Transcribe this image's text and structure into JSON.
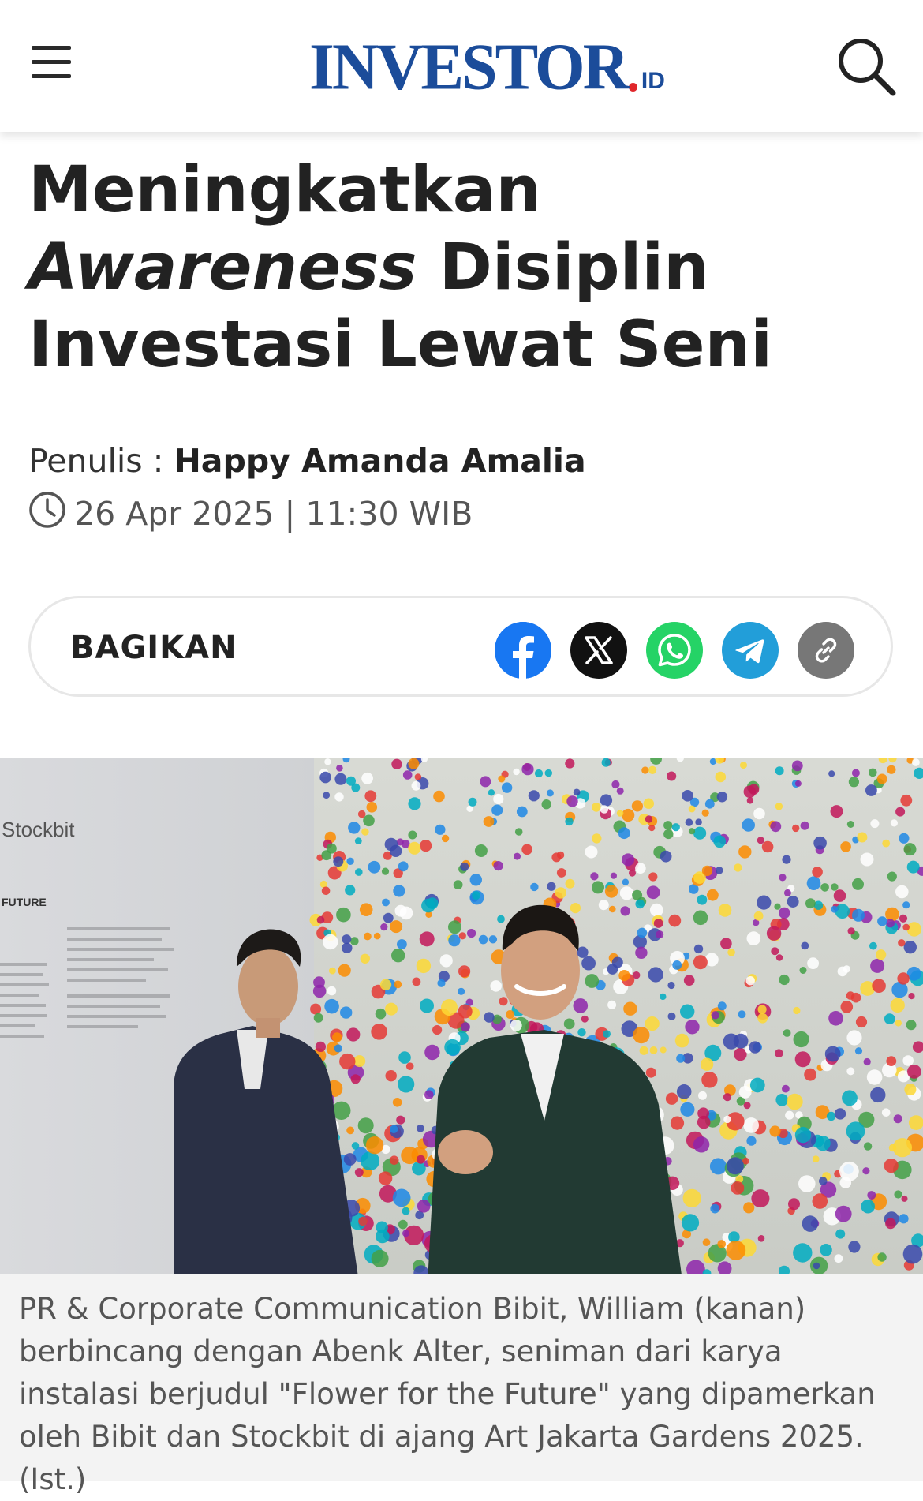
{
  "header": {
    "logo_main": "INVESTOR",
    "logo_suffix": "ID",
    "menu_icon": "hamburger-menu-icon",
    "search_icon": "search-icon"
  },
  "article": {
    "title_part1": "Meningkatkan ",
    "title_italic": "Awareness",
    "title_part2": " Disiplin Investasi Lewat Seni",
    "author_label": "Penulis : ",
    "author": "Happy Amanda Amalia",
    "date": "26 Apr 2025 | 11:30 WIB"
  },
  "share": {
    "label": "BAGIKAN",
    "icons": [
      "facebook-icon",
      "x-icon",
      "whatsapp-icon",
      "telegram-icon",
      "copy-link-icon"
    ],
    "colors": {
      "facebook": "#1877f2",
      "x": "#111111",
      "whatsapp": "#25d366",
      "telegram": "#229ed9",
      "link": "#777777"
    }
  },
  "photo": {
    "wall_logo": "Stockbit",
    "wall_heading": "FUTURE"
  },
  "caption": "PR & Corporate Communication Bibit, William (kanan) berbincang dengan Abenk Alter, seniman dari karya instalasi berjudul \"Flower for the Future\" yang dipamerkan oleh Bibit dan Stockbit di ajang Art Jakarta Gardens 2025. (Ist.)"
}
